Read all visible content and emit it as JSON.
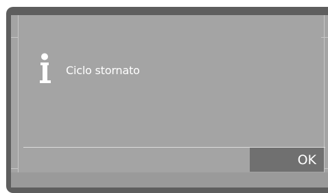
{
  "dialog": {
    "icon": "info-icon",
    "message": "Ciclo stornato",
    "ok_label": "OK"
  },
  "colors": {
    "screen_background": "#a4a4a4",
    "frame": "#5e5e5e",
    "button_background": "#707070",
    "text": "#ffffff"
  }
}
